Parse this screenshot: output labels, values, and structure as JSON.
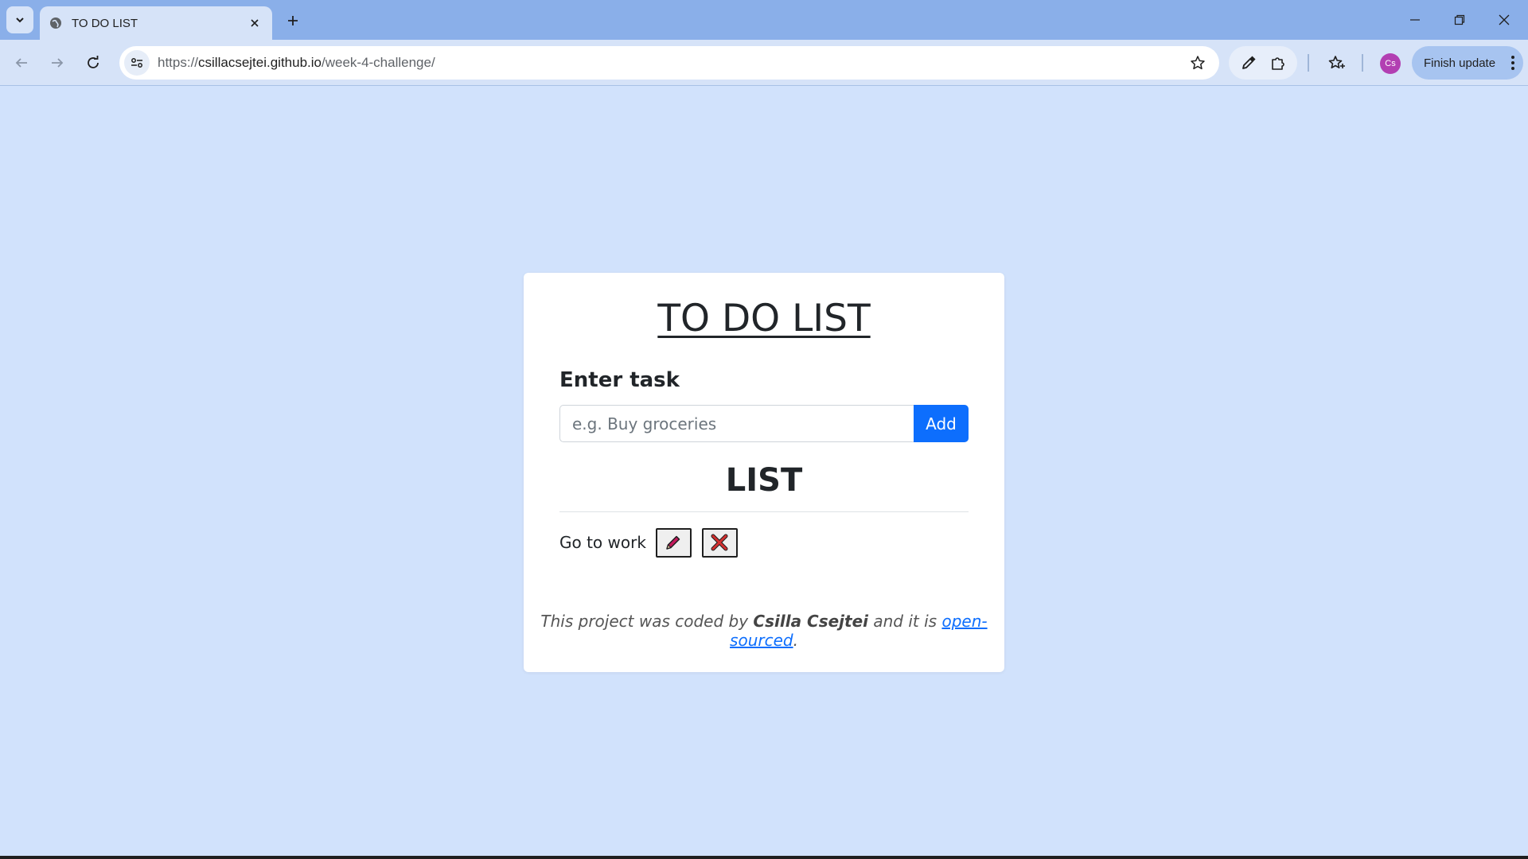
{
  "browser": {
    "tab_title": "TO DO LIST",
    "url_scheme": "https://",
    "url_host": "csillacsejtei.github.io",
    "url_path": "/week-4-challenge/",
    "avatar_initials": "Cs",
    "update_label": "Finish update"
  },
  "app": {
    "title": "TO DO LIST",
    "enter_label": "Enter task",
    "input_placeholder": "e.g. Buy groceries",
    "input_value": "",
    "add_label": "Add",
    "list_title": "LIST",
    "items": [
      {
        "text": "Go to work"
      }
    ],
    "footer": {
      "prefix": "This project was coded by",
      "author": "Csilla Csejtei",
      "middle": "and it is",
      "link": "open-sourced",
      "suffix": "."
    }
  },
  "colors": {
    "page_bg": "#d1e2fc",
    "tabstrip_bg": "#8aafe9",
    "accent": "#0d6efd",
    "avatar": "#b23fb2",
    "edit_icon": "#c2185b",
    "delete_icon": "#d32f2f"
  }
}
